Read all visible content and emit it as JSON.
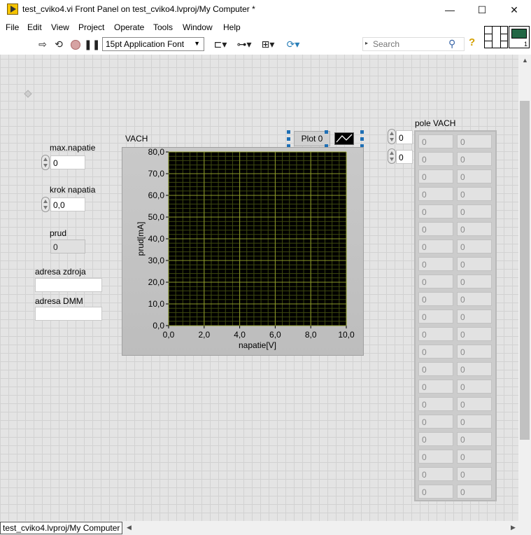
{
  "window": {
    "title": "test_cviko4.vi Front Panel on test_cviko4.lvproj/My Computer *",
    "minimize_glyph": "—",
    "maximize_glyph": "☐",
    "close_glyph": "✕"
  },
  "menu": [
    "File",
    "Edit",
    "View",
    "Project",
    "Operate",
    "Tools",
    "Window",
    "Help"
  ],
  "toolbar": {
    "font_name": "15pt Application Font",
    "search_placeholder": "Search",
    "help_glyph": "?",
    "icons": [
      "run-arrow-icon",
      "run-continuously-icon",
      "abort-icon",
      "pause-icon",
      "align-objects-icon",
      "distribute-objects-icon",
      "resize-objects-icon",
      "reorder-icon"
    ]
  },
  "vi_icon": {
    "number": "1"
  },
  "controls": {
    "max_napatie": {
      "label": "max.napatie",
      "value": "0"
    },
    "krok_napatia": {
      "label": "krok napatia",
      "value": "0,0"
    },
    "prud": {
      "label": "prud",
      "value": "0"
    },
    "adresa_zdroja": {
      "label": "adresa zdroja",
      "value": ""
    },
    "adresa_dmm": {
      "label": "adresa DMM",
      "value": ""
    }
  },
  "graph": {
    "label": "VACH",
    "legend_plot": "Plot 0"
  },
  "array": {
    "label": "pole VACH",
    "index_row": "0",
    "index_col": "0",
    "rows": 21,
    "cols": 2,
    "cell_value": "0"
  },
  "status_bar": {
    "path": "test_cviko4.lvproj/My Computer"
  },
  "chart_data": {
    "type": "scatter",
    "title": "",
    "xlabel": "napatie[V]",
    "ylabel": "prud[mA]",
    "xlim": [
      0,
      10
    ],
    "ylim": [
      0,
      80
    ],
    "x_ticks": [
      "0,0",
      "2,0",
      "4,0",
      "6,0",
      "8,0",
      "10,0"
    ],
    "y_ticks": [
      "0,0",
      "10,0",
      "20,0",
      "30,0",
      "40,0",
      "50,0",
      "60,0",
      "70,0",
      "80,0"
    ],
    "grid": true,
    "background": "#000000",
    "grid_color": "#3f4a10",
    "major_grid_color": "#8d9a2a",
    "series": [
      {
        "name": "Plot 0",
        "x": [],
        "y": []
      }
    ]
  }
}
